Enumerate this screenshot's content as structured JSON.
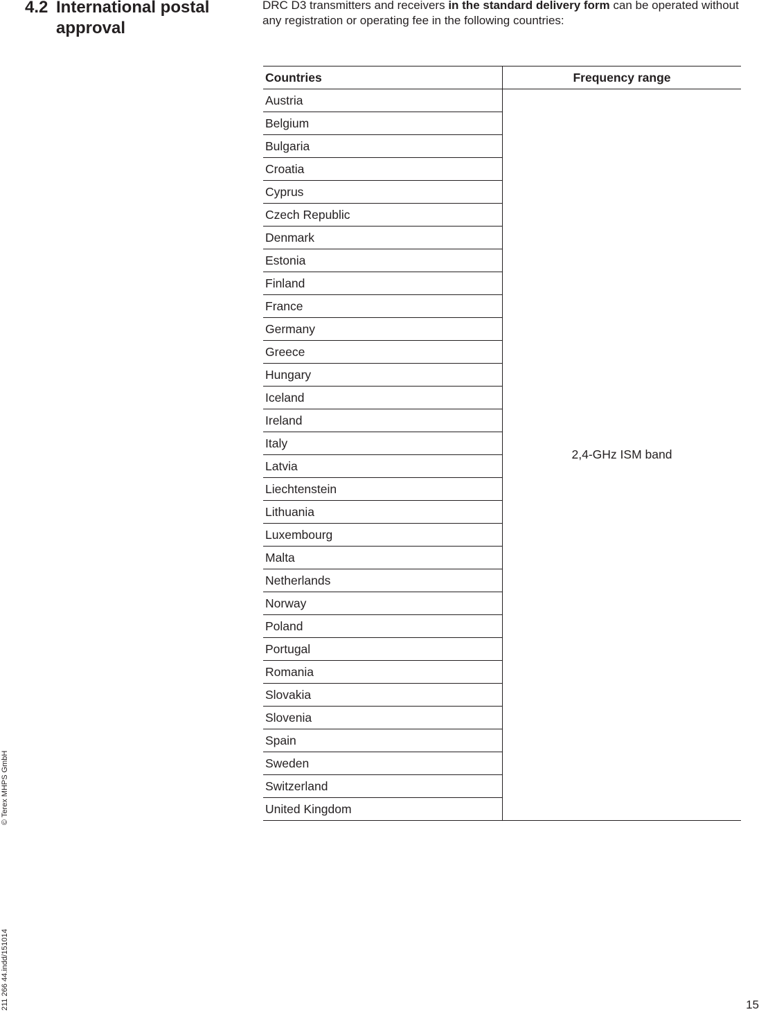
{
  "section": {
    "number": "4.2",
    "title": "International postal approval"
  },
  "intro": {
    "part1": "DRC D3 transmitters and receivers ",
    "bold": "in the standard delivery form",
    "part2": " can be operated without any registration or operating fee in the following countries:"
  },
  "table": {
    "headers": {
      "countries": "Countries",
      "frequency": "Frequency range"
    },
    "frequency_range": "2,4-GHz ISM band",
    "countries": [
      "Austria",
      "Belgium",
      "Bulgaria",
      "Croatia",
      "Cyprus",
      "Czech Republic",
      "Denmark",
      "Estonia",
      "Finland",
      "France",
      "Germany",
      "Greece",
      "Hungary",
      "Iceland",
      "Ireland",
      "Italy",
      "Latvia",
      "Liechtenstein",
      "Lithuania",
      "Luxembourg",
      "Malta",
      "Netherlands",
      "Norway",
      "Poland",
      "Portugal",
      "Romania",
      "Slovakia",
      "Slovenia",
      "Spain",
      "Sweden",
      "Switzerland",
      "United Kingdom"
    ]
  },
  "sidebar": {
    "doc_ref": "211 266 44.indd/151014",
    "copyright": "© Terex MHPS GmbH"
  },
  "page_number": "15"
}
